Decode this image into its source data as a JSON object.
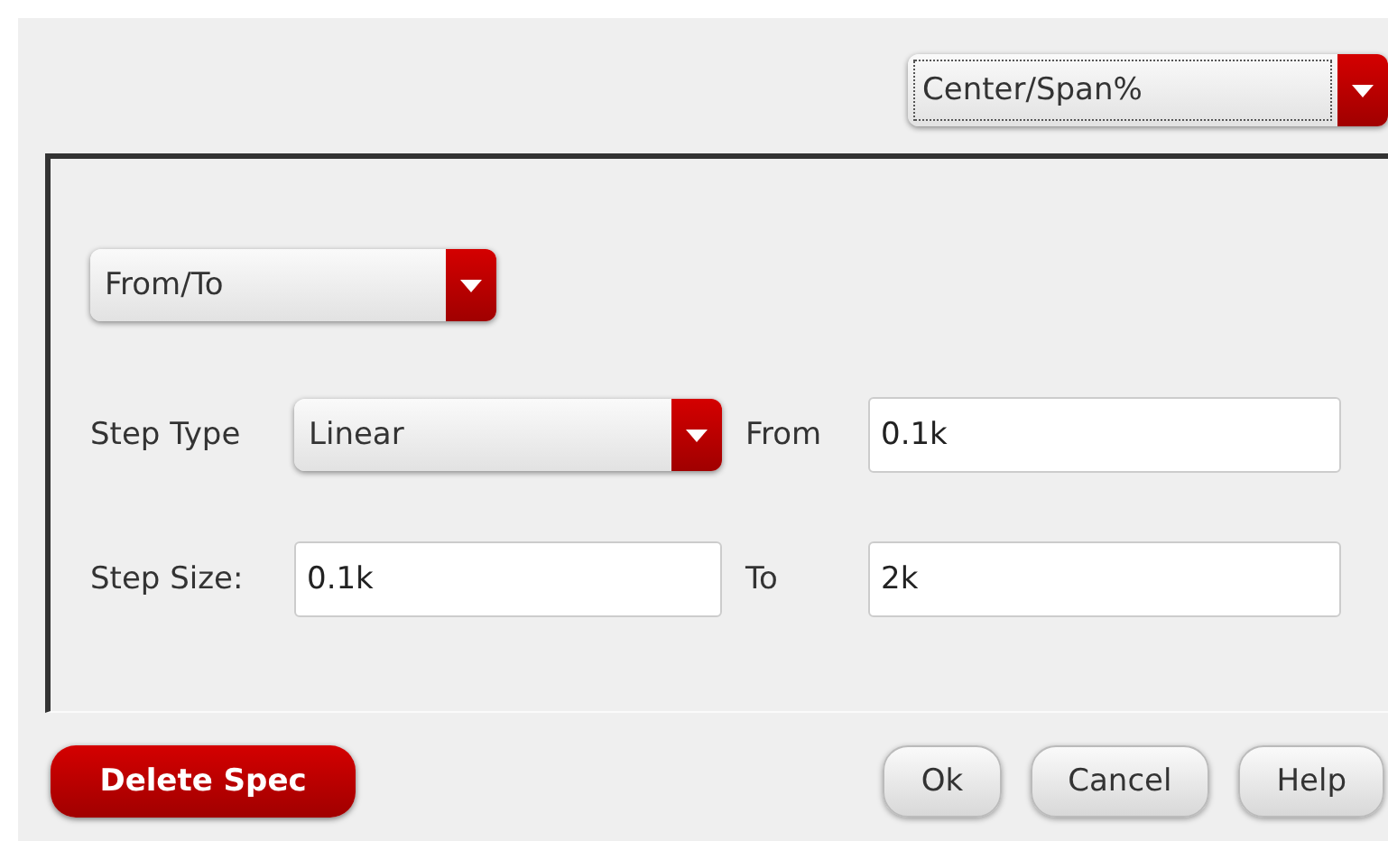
{
  "mode_dropdown": {
    "value": "Center/Span%",
    "focused": true
  },
  "range_dropdown": {
    "value": "From/To",
    "focused": false
  },
  "rows": [
    {
      "label": "Step Type",
      "control": {
        "kind": "dropdown",
        "value": "Linear"
      },
      "field_label": "From",
      "field_value": "0.1k"
    },
    {
      "label": "Step Size:",
      "control": {
        "kind": "input",
        "value": "0.1k"
      },
      "field_label": "To",
      "field_value": "2k"
    }
  ],
  "delete_button": "Delete Spec",
  "buttons": [
    "Ok",
    "Cancel",
    "Help"
  ]
}
